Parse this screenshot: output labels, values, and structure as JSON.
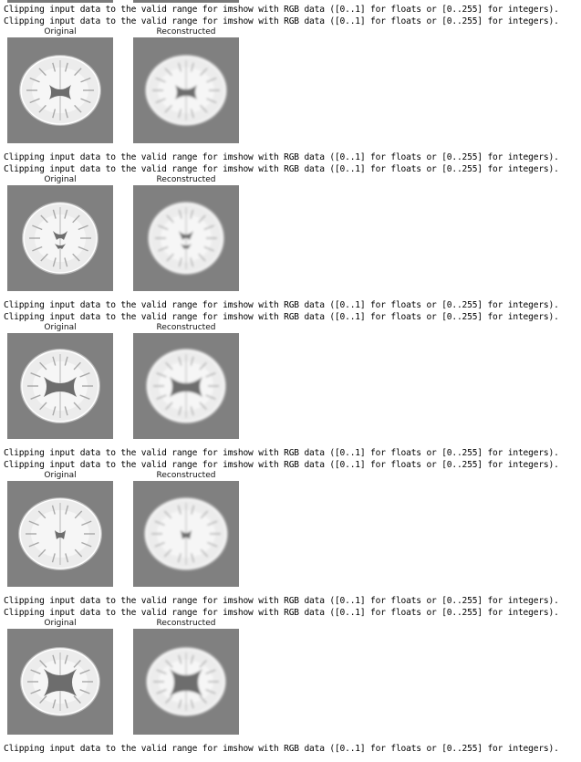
{
  "warning_text": "Clipping input data to the valid range for imshow with RGB data ([0..1] for floats or [0..255] for integers).",
  "titles": {
    "original": "Original",
    "reconstructed": "Reconstructed"
  },
  "colors": {
    "background": "#808080",
    "brain": "#ececec",
    "ventricle": "#6d6d6d"
  },
  "rows": [
    {
      "warnings_before": 2
    },
    {
      "warnings_before": 2
    },
    {
      "warnings_before": 2
    },
    {
      "warnings_before": 2
    },
    {
      "warnings_before": 2
    }
  ],
  "trailing_warnings": 1
}
